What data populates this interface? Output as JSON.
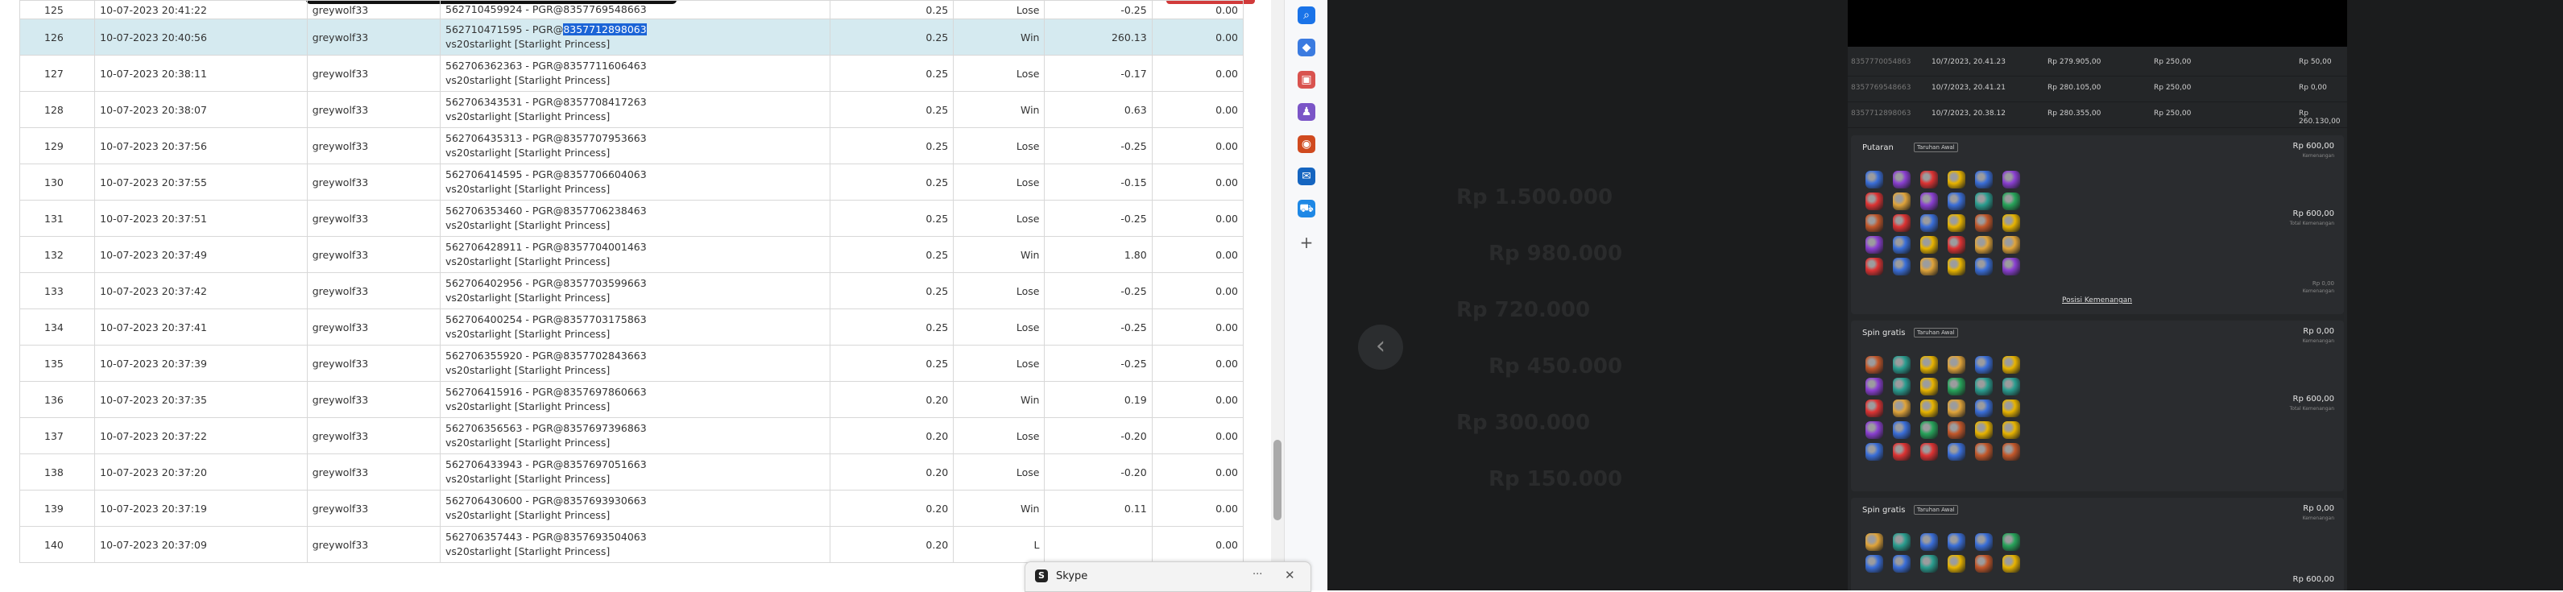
{
  "table": {
    "rows": [
      {
        "no": "125",
        "datetime": "10-07-2023 20:41:22",
        "user": "greywolf33",
        "round_id": "562710459924 - PGR@8357769548663",
        "game": "vs20starlight [Starlight Princess]",
        "bet": "0.25",
        "result": "Lose",
        "winlose": "-0.25",
        "jackpot": "0.00"
      },
      {
        "no": "126",
        "datetime": "10-07-2023 20:40:56",
        "user": "greywolf33",
        "round_id_prefix": "562710471595 - PGR@",
        "round_id_selected": "8357712898063",
        "game": "vs20starlight [Starlight Princess]",
        "bet": "0.25",
        "result": "Win",
        "winlose": "260.13",
        "jackpot": "0.00"
      },
      {
        "no": "127",
        "datetime": "10-07-2023 20:38:11",
        "user": "greywolf33",
        "round_id": "562706362363 - PGR@8357711606463",
        "game": "vs20starlight [Starlight Princess]",
        "bet": "0.25",
        "result": "Lose",
        "winlose": "-0.17",
        "jackpot": "0.00"
      },
      {
        "no": "128",
        "datetime": "10-07-2023 20:38:07",
        "user": "greywolf33",
        "round_id": "562706343531 - PGR@8357708417263",
        "game": "vs20starlight [Starlight Princess]",
        "bet": "0.25",
        "result": "Win",
        "winlose": "0.63",
        "jackpot": "0.00"
      },
      {
        "no": "129",
        "datetime": "10-07-2023 20:37:56",
        "user": "greywolf33",
        "round_id": "562706435313 - PGR@8357707953663",
        "game": "vs20starlight [Starlight Princess]",
        "bet": "0.25",
        "result": "Lose",
        "winlose": "-0.25",
        "jackpot": "0.00"
      },
      {
        "no": "130",
        "datetime": "10-07-2023 20:37:55",
        "user": "greywolf33",
        "round_id": "562706414595 - PGR@8357706604063",
        "game": "vs20starlight [Starlight Princess]",
        "bet": "0.25",
        "result": "Lose",
        "winlose": "-0.15",
        "jackpot": "0.00"
      },
      {
        "no": "131",
        "datetime": "10-07-2023 20:37:51",
        "user": "greywolf33",
        "round_id": "562706353460 - PGR@8357706238463",
        "game": "vs20starlight [Starlight Princess]",
        "bet": "0.25",
        "result": "Lose",
        "winlose": "-0.25",
        "jackpot": "0.00"
      },
      {
        "no": "132",
        "datetime": "10-07-2023 20:37:49",
        "user": "greywolf33",
        "round_id": "562706428911 - PGR@8357704001463",
        "game": "vs20starlight [Starlight Princess]",
        "bet": "0.25",
        "result": "Win",
        "winlose": "1.80",
        "jackpot": "0.00"
      },
      {
        "no": "133",
        "datetime": "10-07-2023 20:37:42",
        "user": "greywolf33",
        "round_id": "562706402956 - PGR@8357703599663",
        "game": "vs20starlight [Starlight Princess]",
        "bet": "0.25",
        "result": "Lose",
        "winlose": "-0.25",
        "jackpot": "0.00"
      },
      {
        "no": "134",
        "datetime": "10-07-2023 20:37:41",
        "user": "greywolf33",
        "round_id": "562706400254 - PGR@8357703175863",
        "game": "vs20starlight [Starlight Princess]",
        "bet": "0.25",
        "result": "Lose",
        "winlose": "-0.25",
        "jackpot": "0.00"
      },
      {
        "no": "135",
        "datetime": "10-07-2023 20:37:39",
        "user": "greywolf33",
        "round_id": "562706355920 - PGR@8357702843663",
        "game": "vs20starlight [Starlight Princess]",
        "bet": "0.25",
        "result": "Lose",
        "winlose": "-0.25",
        "jackpot": "0.00"
      },
      {
        "no": "136",
        "datetime": "10-07-2023 20:37:35",
        "user": "greywolf33",
        "round_id": "562706415916 - PGR@8357697860663",
        "game": "vs20starlight [Starlight Princess]",
        "bet": "0.20",
        "result": "Win",
        "winlose": "0.19",
        "jackpot": "0.00"
      },
      {
        "no": "137",
        "datetime": "10-07-2023 20:37:22",
        "user": "greywolf33",
        "round_id": "562706356563 - PGR@8357697396863",
        "game": "vs20starlight [Starlight Princess]",
        "bet": "0.20",
        "result": "Lose",
        "winlose": "-0.20",
        "jackpot": "0.00"
      },
      {
        "no": "138",
        "datetime": "10-07-2023 20:37:20",
        "user": "greywolf33",
        "round_id": "562706433943 - PGR@8357697051663",
        "game": "vs20starlight [Starlight Princess]",
        "bet": "0.20",
        "result": "Lose",
        "winlose": "-0.20",
        "jackpot": "0.00"
      },
      {
        "no": "139",
        "datetime": "10-07-2023 20:37:19",
        "user": "greywolf33",
        "round_id": "562706430600 - PGR@8357693930663",
        "game": "vs20starlight [Starlight Princess]",
        "bet": "0.20",
        "result": "Win",
        "winlose": "0.11",
        "jackpot": "0.00"
      },
      {
        "no": "140",
        "datetime": "10-07-2023 20:37:09",
        "user": "greywolf33",
        "round_id": "562706357443 - PGR@8357693504063",
        "game": "vs20starlight [Starlight Princess]",
        "bet": "0.20",
        "result": "L",
        "winlose": "",
        "jackpot": "0.00"
      }
    ]
  },
  "skype": {
    "title": "Skype",
    "more": "···",
    "close": "✕"
  },
  "sidebar": {
    "icons": [
      {
        "name": "search-icon",
        "glyph": "⌕",
        "color": "#1a73e8"
      },
      {
        "name": "tag-icon",
        "glyph": "◆",
        "color": "#3b7be0"
      },
      {
        "name": "toolbox-icon",
        "glyph": "▣",
        "color": "#d9534f"
      },
      {
        "name": "people-icon",
        "glyph": "♟",
        "color": "#7b55c7"
      },
      {
        "name": "office-icon",
        "glyph": "◉",
        "color": "#d04a1f"
      },
      {
        "name": "outlook-icon",
        "glyph": "✉",
        "color": "#1565c0"
      },
      {
        "name": "cart-icon",
        "glyph": "⛟",
        "color": "#1e88e5"
      },
      {
        "name": "add-icon",
        "glyph": "+",
        "color": "#666666"
      }
    ]
  },
  "game": {
    "nav_back_glyph": "‹",
    "history": [
      {
        "round": "8357770054863",
        "date": "10/7/2023, 20.41.23",
        "total": "Rp 279.905,00",
        "bet": "Rp 250,00",
        "win": "Rp 50,00"
      },
      {
        "round": "8357769548663",
        "date": "10/7/2023, 20.41.21",
        "total": "Rp 280.105,00",
        "bet": "Rp 250,00",
        "win": "Rp 0,00"
      },
      {
        "round": "8357712898063",
        "date": "10/7/2023, 20.38.12",
        "total": "Rp 280.355,00",
        "bet": "Rp 250,00",
        "win": "Rp 260.130,00"
      }
    ],
    "cards": [
      {
        "title": "Putaran",
        "badge": "Taruhan Awal",
        "amount": "Rp 600,00",
        "sub": "Kemenangan",
        "mid": "Rp 600,00",
        "mid_sub": "Total Kemenangan",
        "corner": "Rp 0,00",
        "corner_sub": "Kemenangan",
        "link": "Posisi Kemenangan",
        "rows": 5
      },
      {
        "title": "Spin gratis",
        "badge": "Taruhan Awal",
        "amount": "Rp 0,00",
        "sub": "Kemenangan",
        "mid": "Rp 600,00",
        "mid_sub": "Total Kemenangan",
        "corner": "",
        "corner_sub": "",
        "link": "",
        "rows": 5
      },
      {
        "title": "Spin gratis",
        "badge": "Taruhan Awal",
        "amount": "Rp 0,00",
        "sub": "Kemenangan",
        "mid": "Rp 600,00",
        "mid_sub": "",
        "corner": "",
        "corner_sub": "",
        "link": "",
        "rows": 2
      }
    ],
    "symbol_colors": [
      "#d33",
      "#e8b400",
      "#2a9d8f",
      "#3a6ed8",
      "#8a3fd1",
      "#c2572a",
      "#27a35a",
      "#e0a43a"
    ],
    "ghost_text": [
      "Rp 1.500.000",
      "Rp 980.000",
      "Rp 720.000",
      "Rp 450.000",
      "Rp 300.000",
      "Rp 150.000"
    ]
  }
}
